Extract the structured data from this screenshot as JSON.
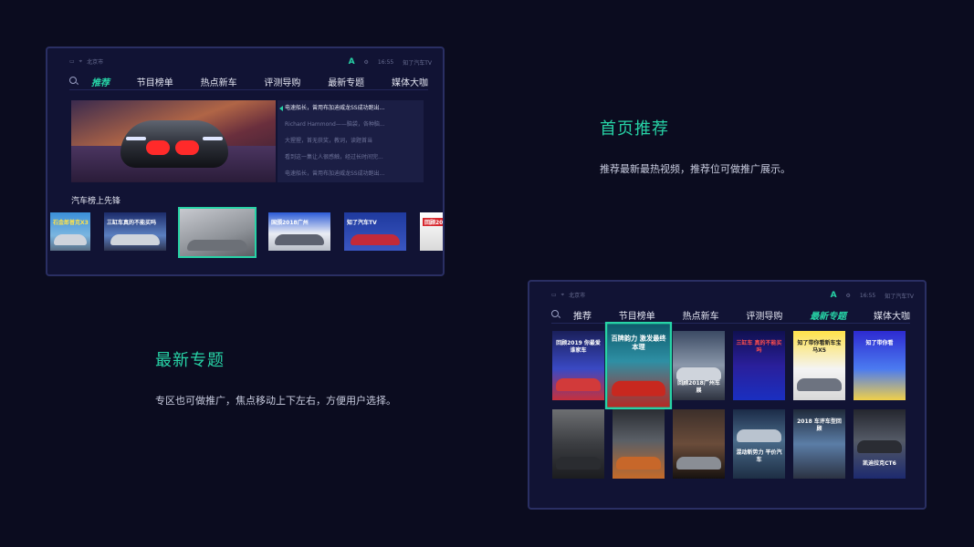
{
  "screen1": {
    "status": {
      "city": "北京市",
      "logo_letter": "A",
      "time": "16:55",
      "brand": "知了汽车TV"
    },
    "tabs": [
      "推荐",
      "节目榜单",
      "热点新车",
      "评测导购",
      "最新专题",
      "媒体大咖"
    ],
    "active_tab": "推荐",
    "news": [
      "电速船长，曾用布加迪威龙SS成功跑出...",
      "Richard Hammond——脑袋，各种脑...",
      "大猩猩，首无获奖，教词，读题首当",
      "看到这一集让人很感触，经过长时间完...",
      "电速船长，曾用布加迪威龙SS成功跑出..."
    ],
    "section_title": "汽车榜上先锋",
    "row_labels": [
      "石金郎普克X3",
      "三缸车真的不能买吗",
      "",
      "国颁2018广州",
      "知了汽车TV",
      "回顾201"
    ]
  },
  "caption1": {
    "title": "首页推荐",
    "desc": "推荐最新最热视频，推荐位可做推广展示。"
  },
  "caption2": {
    "title": "最新专题",
    "desc": "专区也可做推广，焦点移动上下左右，方便用户选择。"
  },
  "screen2": {
    "status": {
      "city": "北京市",
      "logo_letter": "A",
      "time": "16:55",
      "brand": "知了汽车TV"
    },
    "tabs": [
      "推荐",
      "节目榜单",
      "热点新车",
      "评测导购",
      "最新专题",
      "媒体大咖"
    ],
    "active_tab": "最新专题",
    "tiles_row1": [
      "回顾2019 你最爱谁家车",
      "百牌韵力 激发最终本理",
      "回顾2018广州车展",
      "三缸车 真的不能买吗",
      "知了带你看新车宝马X5",
      "知了带你看"
    ],
    "tiles_row2": [
      "",
      "",
      "",
      "混动新势力 平价汽车",
      "2018 车评车型回顾",
      "凯迪拉克CT6"
    ]
  },
  "colors": {
    "accent": "#27d3a6",
    "background": "#0b0c1f",
    "panel": "#111334",
    "border": "#2a2f63"
  }
}
